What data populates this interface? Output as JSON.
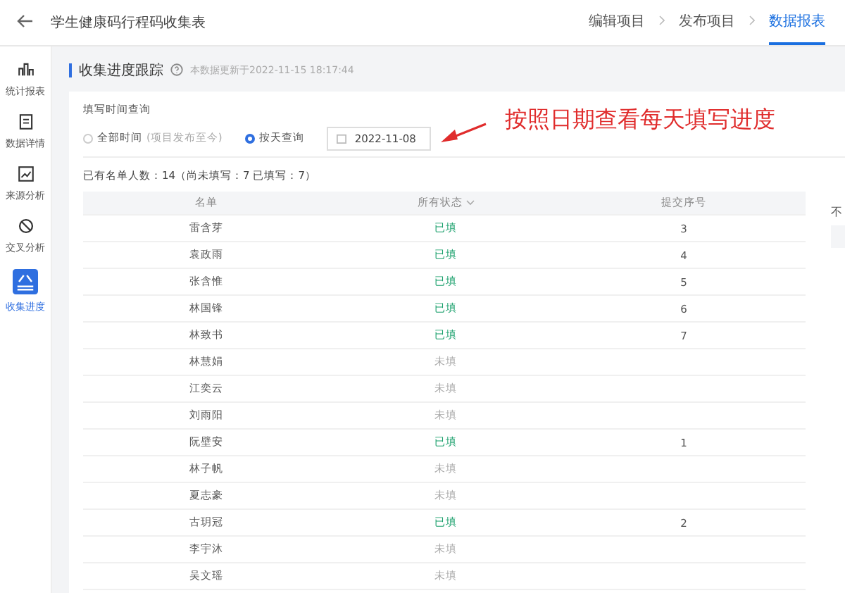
{
  "header": {
    "title": "学生健康码行程码收集表",
    "steps": [
      {
        "label": "编辑项目",
        "selected": false
      },
      {
        "label": "发布项目",
        "selected": false
      },
      {
        "label": "数据报表",
        "selected": true
      }
    ]
  },
  "sidebar": {
    "items": [
      {
        "kind": "bars",
        "label": "统计报表",
        "selected": false
      },
      {
        "kind": "doc",
        "label": "数据详情",
        "selected": false
      },
      {
        "kind": "chart",
        "label": "来源分析",
        "selected": false
      },
      {
        "kind": "cross",
        "label": "交叉分析",
        "selected": false
      },
      {
        "kind": "progress",
        "label": "收集进度",
        "selected": true
      }
    ]
  },
  "section": {
    "title": "收集进度跟踪",
    "updated": "本数据更新于2022-11-15 18:17:44"
  },
  "filter": {
    "label": "填写时间查询",
    "options": [
      {
        "label": "全部时间",
        "hint": "(项目发布至今)",
        "selected": false
      },
      {
        "label": "按天查询",
        "selected": true
      }
    ],
    "date": "2022-11-08"
  },
  "annotation": "按照日期查看每天填写进度",
  "summary": "已有名单人数：14（尚未填写：7 已填写：7）",
  "side_panel_text": "不",
  "table": {
    "columns": [
      "名单",
      "所有状态",
      "提交序号"
    ],
    "rows": [
      {
        "name": "雷含芽",
        "filled": true,
        "status": "已填",
        "seq": "3"
      },
      {
        "name": "袁政雨",
        "filled": true,
        "status": "已填",
        "seq": "4"
      },
      {
        "name": "张含惟",
        "filled": true,
        "status": "已填",
        "seq": "5"
      },
      {
        "name": "林国锋",
        "filled": true,
        "status": "已填",
        "seq": "6"
      },
      {
        "name": "林致书",
        "filled": true,
        "status": "已填",
        "seq": "7"
      },
      {
        "name": "林慧娟",
        "filled": false,
        "status": "未填"
      },
      {
        "name": "江奕云",
        "filled": false,
        "status": "未填"
      },
      {
        "name": "刘雨阳",
        "filled": false,
        "status": "未填"
      },
      {
        "name": "阮壁安",
        "filled": true,
        "status": "已填",
        "seq": "1"
      },
      {
        "name": "林子帆",
        "filled": false,
        "status": "未填"
      },
      {
        "name": "夏志豪",
        "filled": false,
        "status": "未填"
      },
      {
        "name": "古玥冠",
        "filled": true,
        "status": "已填",
        "seq": "2"
      },
      {
        "name": "李宇沐",
        "filled": false,
        "status": "未填"
      },
      {
        "name": "吴文瑶",
        "filled": false,
        "status": "未填"
      }
    ]
  }
}
